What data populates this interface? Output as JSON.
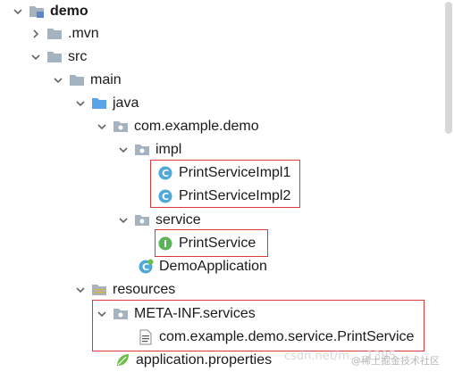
{
  "tree": {
    "root": "demo",
    "mvn": ".mvn",
    "src": "src",
    "main": "main",
    "java": "java",
    "package": "com.example.demo",
    "impl": "impl",
    "impl1": "PrintServiceImpl1",
    "impl2": "PrintServiceImpl2",
    "service_pkg": "service",
    "print_service": "PrintService",
    "demo_app": "DemoApplication",
    "resources": "resources",
    "meta_inf": "META-INF.services",
    "service_file": "com.example.demo.service.PrintService",
    "app_props": "application.properties"
  },
  "watermark": "@稀土掘金技术社区",
  "watermark_faded": "csdn.net/m..._1395",
  "colors": {
    "highlight": "#d93a3a",
    "folder": "#9aa7b4",
    "java_folder": "#5aa3e6",
    "class_icon": "#4fa8d8",
    "interface_icon": "#59b359"
  }
}
